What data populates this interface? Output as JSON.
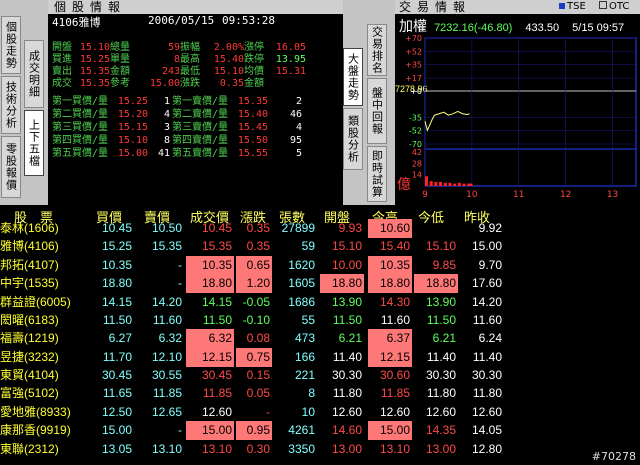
{
  "left_panel": {
    "title": "個股情報",
    "tabs_outer": [
      "個股走勢",
      "技術分析",
      "零股報價"
    ],
    "tabs_inner": [
      "成交明細",
      "上下五檔"
    ],
    "stock_label": "4106雅博",
    "date": "2006/05/15",
    "time": "09:53:28",
    "summary_rows": [
      {
        "l1": "開盤",
        "v1": "15.10",
        "l2": "總量",
        "v2": "59",
        "l3": "振幅",
        "v3": "2.00%",
        "l4": "漲停",
        "v4": "16.05"
      },
      {
        "l1": "買進",
        "v1": "15.25",
        "l2": "單量",
        "v2": "8",
        "l3": "最高",
        "v3": "15.40",
        "l4": "跌停",
        "v4": "13.95"
      },
      {
        "l1": "賣出",
        "v1": "15.35",
        "l2": "金額",
        "v2": "243",
        "l3": "最低",
        "v3": "15.10",
        "l4": "均價",
        "v4": "15.31"
      },
      {
        "l1": "成交",
        "v1": "15.35",
        "l2": "參考",
        "v2": "15.00",
        "l3": "漲跌",
        "v3": "0.35",
        "l4": "金額",
        "v4": ""
      }
    ],
    "depth_rows": [
      {
        "bl": "第一買價/量",
        "bp": "15.25",
        "bq": "1",
        "al": "第一賣價/量",
        "ap": "15.35",
        "aq": "2"
      },
      {
        "bl": "第二買價/量",
        "bp": "15.20",
        "bq": "4",
        "al": "第二賣價/量",
        "ap": "15.40",
        "aq": "46"
      },
      {
        "bl": "第三買價/量",
        "bp": "15.15",
        "bq": "3",
        "al": "第三賣價/量",
        "ap": "15.45",
        "aq": "4"
      },
      {
        "bl": "第四買價/量",
        "bp": "15.10",
        "bq": "8",
        "al": "第四賣價/量",
        "ap": "15.50",
        "aq": "95"
      },
      {
        "bl": "第五買價/量",
        "bp": "15.00",
        "bq": "41",
        "al": "第五賣價/量",
        "ap": "15.55",
        "aq": "5"
      }
    ]
  },
  "right_panel": {
    "title": "交易情報",
    "legend": [
      "TSE",
      "OTC"
    ],
    "tabs_outer": [
      "大盤走勢",
      "類股分析"
    ],
    "tabs_inner": [
      "交易排名",
      "盤中回報",
      "即時試算"
    ],
    "index_label": "加權",
    "index_value": "7232.16",
    "index_change": "(-46.80)",
    "volume": "433.50",
    "index_time": "5/15 09:57",
    "price_left": "7278.96",
    "vol_label": "億"
  },
  "chart_data": {
    "type": "line",
    "y_ticks": [
      "+70",
      "+52",
      "+35",
      "+17",
      "+0",
      "-35",
      "-52",
      "-70"
    ],
    "vol_ticks": [
      "42",
      "28",
      "14"
    ],
    "x_ticks": [
      "9",
      "10",
      "11",
      "12",
      "13"
    ],
    "xlim": [
      9,
      13.5
    ],
    "ylim": [
      -70,
      70
    ],
    "series": [
      {
        "values": [
          [
            9.0,
            -40
          ],
          [
            9.05,
            -52
          ],
          [
            9.1,
            -45
          ],
          [
            9.15,
            -38
          ],
          [
            9.2,
            -32
          ],
          [
            9.3,
            -30
          ],
          [
            9.4,
            -28
          ],
          [
            9.5,
            -32
          ],
          [
            9.6,
            -30
          ],
          [
            9.7,
            -27
          ],
          [
            9.8,
            -30
          ],
          [
            9.9,
            -31
          ],
          [
            9.95,
            -30
          ]
        ]
      }
    ],
    "volume_bars": [
      [
        9.0,
        12
      ],
      [
        9.1,
        6
      ],
      [
        9.2,
        5
      ],
      [
        9.3,
        5
      ],
      [
        9.4,
        4
      ],
      [
        9.5,
        4
      ],
      [
        9.6,
        3
      ],
      [
        9.7,
        4
      ],
      [
        9.8,
        3
      ],
      [
        9.9,
        3
      ],
      [
        9.95,
        3
      ]
    ]
  },
  "table": {
    "headers": [
      "股　票",
      "買價",
      "賣價",
      "成交價",
      "漲跌",
      "張數",
      "開盤",
      "今高",
      "今低",
      "昨收"
    ],
    "rows": [
      {
        "name": "泰林(1606)",
        "cells": [
          "10.45",
          "10.50",
          "10.45",
          "0.35",
          "27899",
          "9.93",
          "10.60",
          "",
          "9.92"
        ],
        "hl": [
          6
        ]
      },
      {
        "name": "雅博(4106)",
        "cells": [
          "15.25",
          "15.35",
          "15.35",
          "0.35",
          "59",
          "15.10",
          "15.40",
          "15.10",
          "15.00"
        ],
        "hl": []
      },
      {
        "name": "邦拓(4107)",
        "cells": [
          "10.35",
          "-",
          "10.35",
          "0.65",
          "1620",
          "10.00",
          "10.35",
          "9.85",
          "9.70"
        ],
        "hl": [
          2,
          3,
          6
        ]
      },
      {
        "name": "中宇(1535)",
        "cells": [
          "18.80",
          "-",
          "18.80",
          "1.20",
          "1605",
          "18.80",
          "18.80",
          "18.80",
          "17.60"
        ],
        "hl": [
          2,
          3,
          5,
          6,
          7
        ]
      },
      {
        "name": "群益證(6005)",
        "cells": [
          "14.15",
          "14.20",
          "14.15",
          "-0.05",
          "1686",
          "13.90",
          "14.30",
          "13.90",
          "14.20"
        ],
        "hl": []
      },
      {
        "name": "閎曜(6183)",
        "cells": [
          "11.50",
          "11.60",
          "11.50",
          "-0.10",
          "55",
          "11.50",
          "11.60",
          "11.50",
          "11.60"
        ],
        "hl": []
      },
      {
        "name": "福壽(1219)",
        "cells": [
          "6.27",
          "6.32",
          "6.32",
          "0.08",
          "473",
          "6.21",
          "6.37",
          "6.21",
          "6.24"
        ],
        "hl": [
          2,
          6
        ]
      },
      {
        "name": "昱捷(3232)",
        "cells": [
          "11.70",
          "12.10",
          "12.15",
          "0.75",
          "166",
          "11.40",
          "12.15",
          "11.40",
          "11.40"
        ],
        "hl": [
          2,
          3,
          6
        ]
      },
      {
        "name": "東貿(4104)",
        "cells": [
          "30.45",
          "30.55",
          "30.45",
          "0.15",
          "221",
          "30.30",
          "30.60",
          "30.30",
          "30.30"
        ],
        "hl": []
      },
      {
        "name": "富強(5102)",
        "cells": [
          "11.65",
          "11.85",
          "11.85",
          "0.05",
          "8",
          "11.80",
          "11.85",
          "11.80",
          "11.80"
        ],
        "hl": []
      },
      {
        "name": "愛地雅(8933)",
        "cells": [
          "12.50",
          "12.65",
          "12.60",
          "-",
          "10",
          "12.60",
          "12.60",
          "12.60",
          "12.60"
        ],
        "hl": []
      },
      {
        "name": "康那香(9919)",
        "cells": [
          "15.00",
          "-",
          "15.00",
          "0.95",
          "4261",
          "14.60",
          "15.00",
          "14.35",
          "14.05"
        ],
        "hl": [
          2,
          3,
          6
        ]
      },
      {
        "name": "東聯(2312)",
        "cells": [
          "13.05",
          "13.10",
          "13.10",
          "0.30",
          "3350",
          "13.00",
          "13.10",
          "13.00",
          "12.80"
        ],
        "hl": []
      }
    ]
  },
  "watermark": "#70278"
}
